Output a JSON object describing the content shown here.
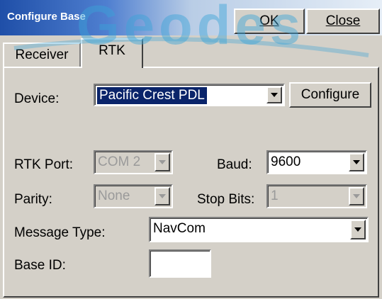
{
  "window": {
    "title": "Configure Base",
    "ok_label": "OK",
    "close_label": "Close",
    "watermark": "Geodes"
  },
  "tabs": [
    {
      "label": "Receiver",
      "active": false
    },
    {
      "label": "RTK",
      "active": true
    }
  ],
  "form": {
    "device_label": "Device:",
    "device_value": "Pacific Crest PDL",
    "configure_label": "Configure",
    "rtk_port_label": "RTK Port:",
    "rtk_port_value": "COM 2",
    "baud_label": "Baud:",
    "baud_value": "9600",
    "parity_label": "Parity:",
    "parity_value": "None",
    "stop_bits_label": "Stop Bits:",
    "stop_bits_value": "1",
    "message_type_label": "Message Type:",
    "message_type_value": "NavCom",
    "base_id_label": "Base ID:",
    "base_id_value": ""
  },
  "colors": {
    "titlebar_start": "#1f4fa8",
    "selection": "#0a246a",
    "face": "#d4d0c8",
    "watermark": "#3aa4d8"
  }
}
